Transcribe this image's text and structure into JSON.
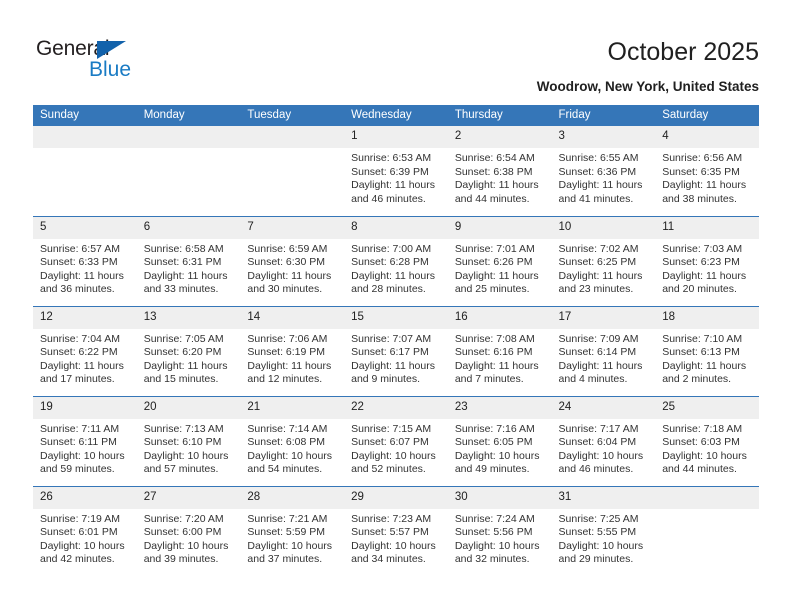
{
  "brand": {
    "name_top": "General",
    "name_bottom": "Blue",
    "triangle_icon": "triangle-icon",
    "color_dark": "#231f20",
    "color_blue": "#1a7bc4"
  },
  "header": {
    "title": "October 2025",
    "location": "Woodrow, New York, United States"
  },
  "theme": {
    "header_blue": "#3576B8",
    "daynum_band": "#EFEFEF",
    "text": "#333333"
  },
  "calendar": {
    "weekday_headers": [
      "Sunday",
      "Monday",
      "Tuesday",
      "Wednesday",
      "Thursday",
      "Friday",
      "Saturday"
    ],
    "labels": {
      "sunrise": "Sunrise:",
      "sunset": "Sunset:",
      "daylight": "Daylight:"
    },
    "weeks": [
      [
        {
          "day": "",
          "empty": true
        },
        {
          "day": "",
          "empty": true
        },
        {
          "day": "",
          "empty": true
        },
        {
          "day": "1",
          "sunrise": "Sunrise: 6:53 AM",
          "sunset": "Sunset: 6:39 PM",
          "daylight_line1": "Daylight: 11 hours",
          "daylight_line2": "and 46 minutes."
        },
        {
          "day": "2",
          "sunrise": "Sunrise: 6:54 AM",
          "sunset": "Sunset: 6:38 PM",
          "daylight_line1": "Daylight: 11 hours",
          "daylight_line2": "and 44 minutes."
        },
        {
          "day": "3",
          "sunrise": "Sunrise: 6:55 AM",
          "sunset": "Sunset: 6:36 PM",
          "daylight_line1": "Daylight: 11 hours",
          "daylight_line2": "and 41 minutes."
        },
        {
          "day": "4",
          "sunrise": "Sunrise: 6:56 AM",
          "sunset": "Sunset: 6:35 PM",
          "daylight_line1": "Daylight: 11 hours",
          "daylight_line2": "and 38 minutes."
        }
      ],
      [
        {
          "day": "5",
          "sunrise": "Sunrise: 6:57 AM",
          "sunset": "Sunset: 6:33 PM",
          "daylight_line1": "Daylight: 11 hours",
          "daylight_line2": "and 36 minutes."
        },
        {
          "day": "6",
          "sunrise": "Sunrise: 6:58 AM",
          "sunset": "Sunset: 6:31 PM",
          "daylight_line1": "Daylight: 11 hours",
          "daylight_line2": "and 33 minutes."
        },
        {
          "day": "7",
          "sunrise": "Sunrise: 6:59 AM",
          "sunset": "Sunset: 6:30 PM",
          "daylight_line1": "Daylight: 11 hours",
          "daylight_line2": "and 30 minutes."
        },
        {
          "day": "8",
          "sunrise": "Sunrise: 7:00 AM",
          "sunset": "Sunset: 6:28 PM",
          "daylight_line1": "Daylight: 11 hours",
          "daylight_line2": "and 28 minutes."
        },
        {
          "day": "9",
          "sunrise": "Sunrise: 7:01 AM",
          "sunset": "Sunset: 6:26 PM",
          "daylight_line1": "Daylight: 11 hours",
          "daylight_line2": "and 25 minutes."
        },
        {
          "day": "10",
          "sunrise": "Sunrise: 7:02 AM",
          "sunset": "Sunset: 6:25 PM",
          "daylight_line1": "Daylight: 11 hours",
          "daylight_line2": "and 23 minutes."
        },
        {
          "day": "11",
          "sunrise": "Sunrise: 7:03 AM",
          "sunset": "Sunset: 6:23 PM",
          "daylight_line1": "Daylight: 11 hours",
          "daylight_line2": "and 20 minutes."
        }
      ],
      [
        {
          "day": "12",
          "sunrise": "Sunrise: 7:04 AM",
          "sunset": "Sunset: 6:22 PM",
          "daylight_line1": "Daylight: 11 hours",
          "daylight_line2": "and 17 minutes."
        },
        {
          "day": "13",
          "sunrise": "Sunrise: 7:05 AM",
          "sunset": "Sunset: 6:20 PM",
          "daylight_line1": "Daylight: 11 hours",
          "daylight_line2": "and 15 minutes."
        },
        {
          "day": "14",
          "sunrise": "Sunrise: 7:06 AM",
          "sunset": "Sunset: 6:19 PM",
          "daylight_line1": "Daylight: 11 hours",
          "daylight_line2": "and 12 minutes."
        },
        {
          "day": "15",
          "sunrise": "Sunrise: 7:07 AM",
          "sunset": "Sunset: 6:17 PM",
          "daylight_line1": "Daylight: 11 hours",
          "daylight_line2": "and 9 minutes."
        },
        {
          "day": "16",
          "sunrise": "Sunrise: 7:08 AM",
          "sunset": "Sunset: 6:16 PM",
          "daylight_line1": "Daylight: 11 hours",
          "daylight_line2": "and 7 minutes."
        },
        {
          "day": "17",
          "sunrise": "Sunrise: 7:09 AM",
          "sunset": "Sunset: 6:14 PM",
          "daylight_line1": "Daylight: 11 hours",
          "daylight_line2": "and 4 minutes."
        },
        {
          "day": "18",
          "sunrise": "Sunrise: 7:10 AM",
          "sunset": "Sunset: 6:13 PM",
          "daylight_line1": "Daylight: 11 hours",
          "daylight_line2": "and 2 minutes."
        }
      ],
      [
        {
          "day": "19",
          "sunrise": "Sunrise: 7:11 AM",
          "sunset": "Sunset: 6:11 PM",
          "daylight_line1": "Daylight: 10 hours",
          "daylight_line2": "and 59 minutes."
        },
        {
          "day": "20",
          "sunrise": "Sunrise: 7:13 AM",
          "sunset": "Sunset: 6:10 PM",
          "daylight_line1": "Daylight: 10 hours",
          "daylight_line2": "and 57 minutes."
        },
        {
          "day": "21",
          "sunrise": "Sunrise: 7:14 AM",
          "sunset": "Sunset: 6:08 PM",
          "daylight_line1": "Daylight: 10 hours",
          "daylight_line2": "and 54 minutes."
        },
        {
          "day": "22",
          "sunrise": "Sunrise: 7:15 AM",
          "sunset": "Sunset: 6:07 PM",
          "daylight_line1": "Daylight: 10 hours",
          "daylight_line2": "and 52 minutes."
        },
        {
          "day": "23",
          "sunrise": "Sunrise: 7:16 AM",
          "sunset": "Sunset: 6:05 PM",
          "daylight_line1": "Daylight: 10 hours",
          "daylight_line2": "and 49 minutes."
        },
        {
          "day": "24",
          "sunrise": "Sunrise: 7:17 AM",
          "sunset": "Sunset: 6:04 PM",
          "daylight_line1": "Daylight: 10 hours",
          "daylight_line2": "and 46 minutes."
        },
        {
          "day": "25",
          "sunrise": "Sunrise: 7:18 AM",
          "sunset": "Sunset: 6:03 PM",
          "daylight_line1": "Daylight: 10 hours",
          "daylight_line2": "and 44 minutes."
        }
      ],
      [
        {
          "day": "26",
          "sunrise": "Sunrise: 7:19 AM",
          "sunset": "Sunset: 6:01 PM",
          "daylight_line1": "Daylight: 10 hours",
          "daylight_line2": "and 42 minutes."
        },
        {
          "day": "27",
          "sunrise": "Sunrise: 7:20 AM",
          "sunset": "Sunset: 6:00 PM",
          "daylight_line1": "Daylight: 10 hours",
          "daylight_line2": "and 39 minutes."
        },
        {
          "day": "28",
          "sunrise": "Sunrise: 7:21 AM",
          "sunset": "Sunset: 5:59 PM",
          "daylight_line1": "Daylight: 10 hours",
          "daylight_line2": "and 37 minutes."
        },
        {
          "day": "29",
          "sunrise": "Sunrise: 7:23 AM",
          "sunset": "Sunset: 5:57 PM",
          "daylight_line1": "Daylight: 10 hours",
          "daylight_line2": "and 34 minutes."
        },
        {
          "day": "30",
          "sunrise": "Sunrise: 7:24 AM",
          "sunset": "Sunset: 5:56 PM",
          "daylight_line1": "Daylight: 10 hours",
          "daylight_line2": "and 32 minutes."
        },
        {
          "day": "31",
          "sunrise": "Sunrise: 7:25 AM",
          "sunset": "Sunset: 5:55 PM",
          "daylight_line1": "Daylight: 10 hours",
          "daylight_line2": "and 29 minutes."
        },
        {
          "day": "",
          "empty": true
        }
      ]
    ]
  }
}
